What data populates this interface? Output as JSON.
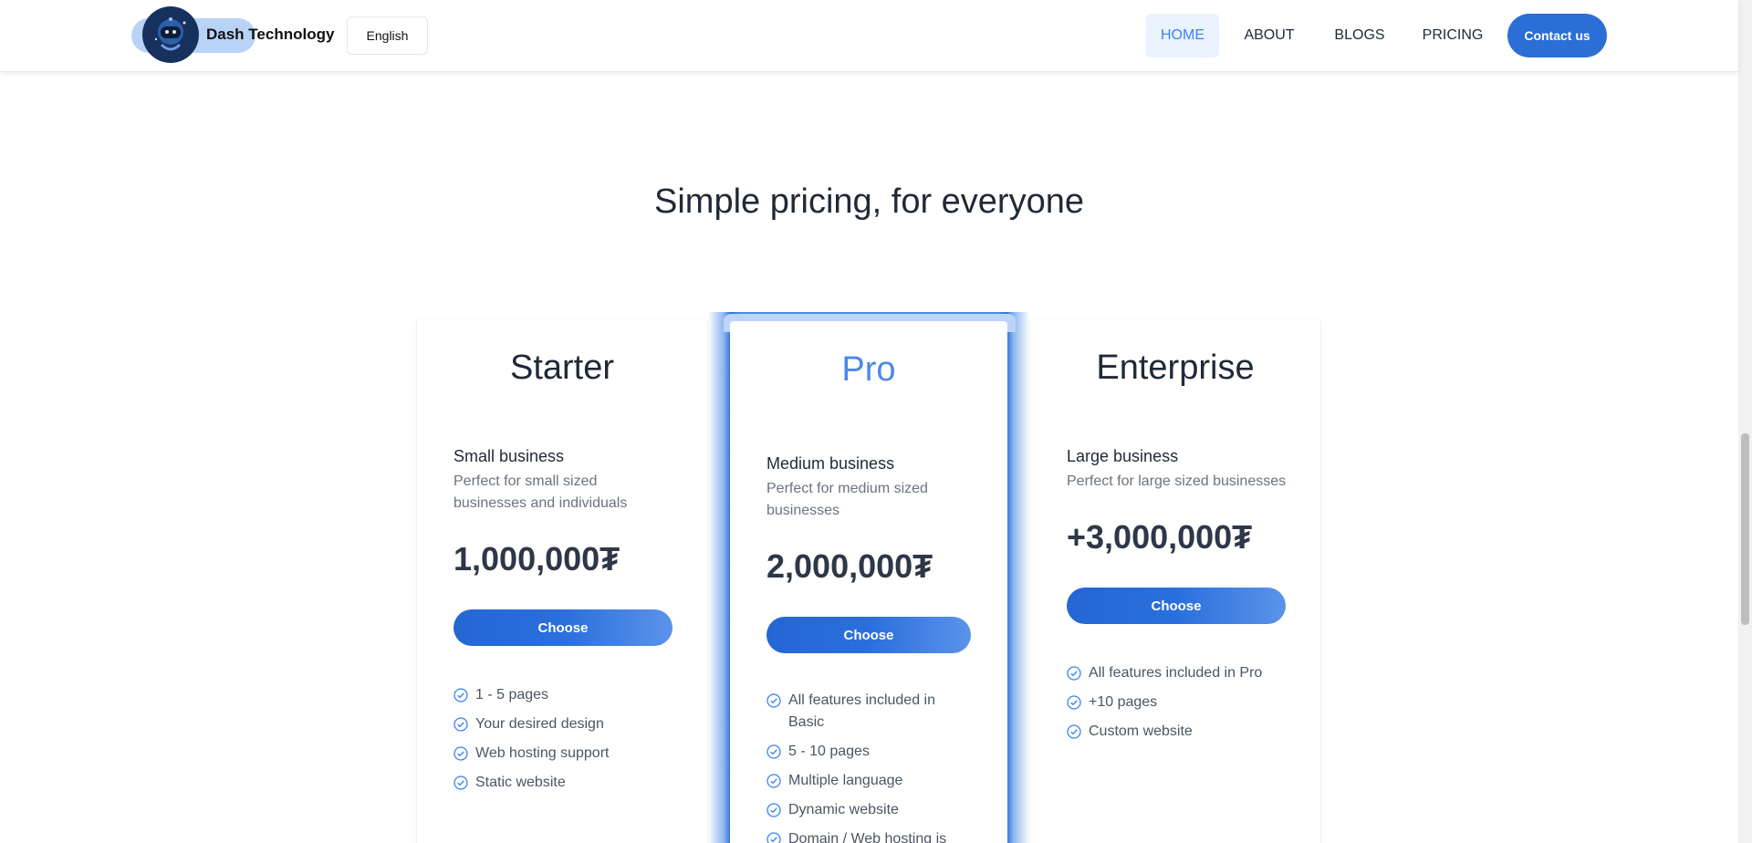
{
  "header": {
    "brand": "Dash Technology",
    "language": "English",
    "nav": [
      "HOME",
      "ABOUT",
      "BLOGS",
      "PRICING"
    ],
    "active_nav": "HOME",
    "contact": "Contact us"
  },
  "section": {
    "title": "Simple pricing, for everyone"
  },
  "plans": [
    {
      "name": "Starter",
      "tier": "Small business",
      "description": "Perfect for small sized businesses and individuals",
      "price": "1,000,000₮",
      "button": "Choose",
      "features": [
        "1 - 5 pages",
        "Your desired design",
        "Web hosting support",
        "Static website"
      ]
    },
    {
      "name": "Pro",
      "tier": "Medium business",
      "description": "Perfect for medium sized businesses",
      "price": "2,000,000₮",
      "button": "Choose",
      "features": [
        "All features included in Basic",
        "5 - 10 pages",
        "Multiple language",
        "Dynamic website",
        "Domain / Web hosting is"
      ]
    },
    {
      "name": "Enterprise",
      "tier": "Large business",
      "description": "Perfect for large sized businesses",
      "price": "+3,000,000₮",
      "button": "Choose",
      "features": [
        "All features included in Pro",
        "+10 pages",
        "Custom website"
      ]
    }
  ],
  "colors": {
    "accent": "#2b6fd6",
    "accent_light": "#4a8ae6",
    "nav_active_bg": "#eaf3fd",
    "check": "#3b82f6"
  },
  "icons": {
    "logo": "robot-astronaut-logo",
    "feature": "check-circle-icon"
  }
}
